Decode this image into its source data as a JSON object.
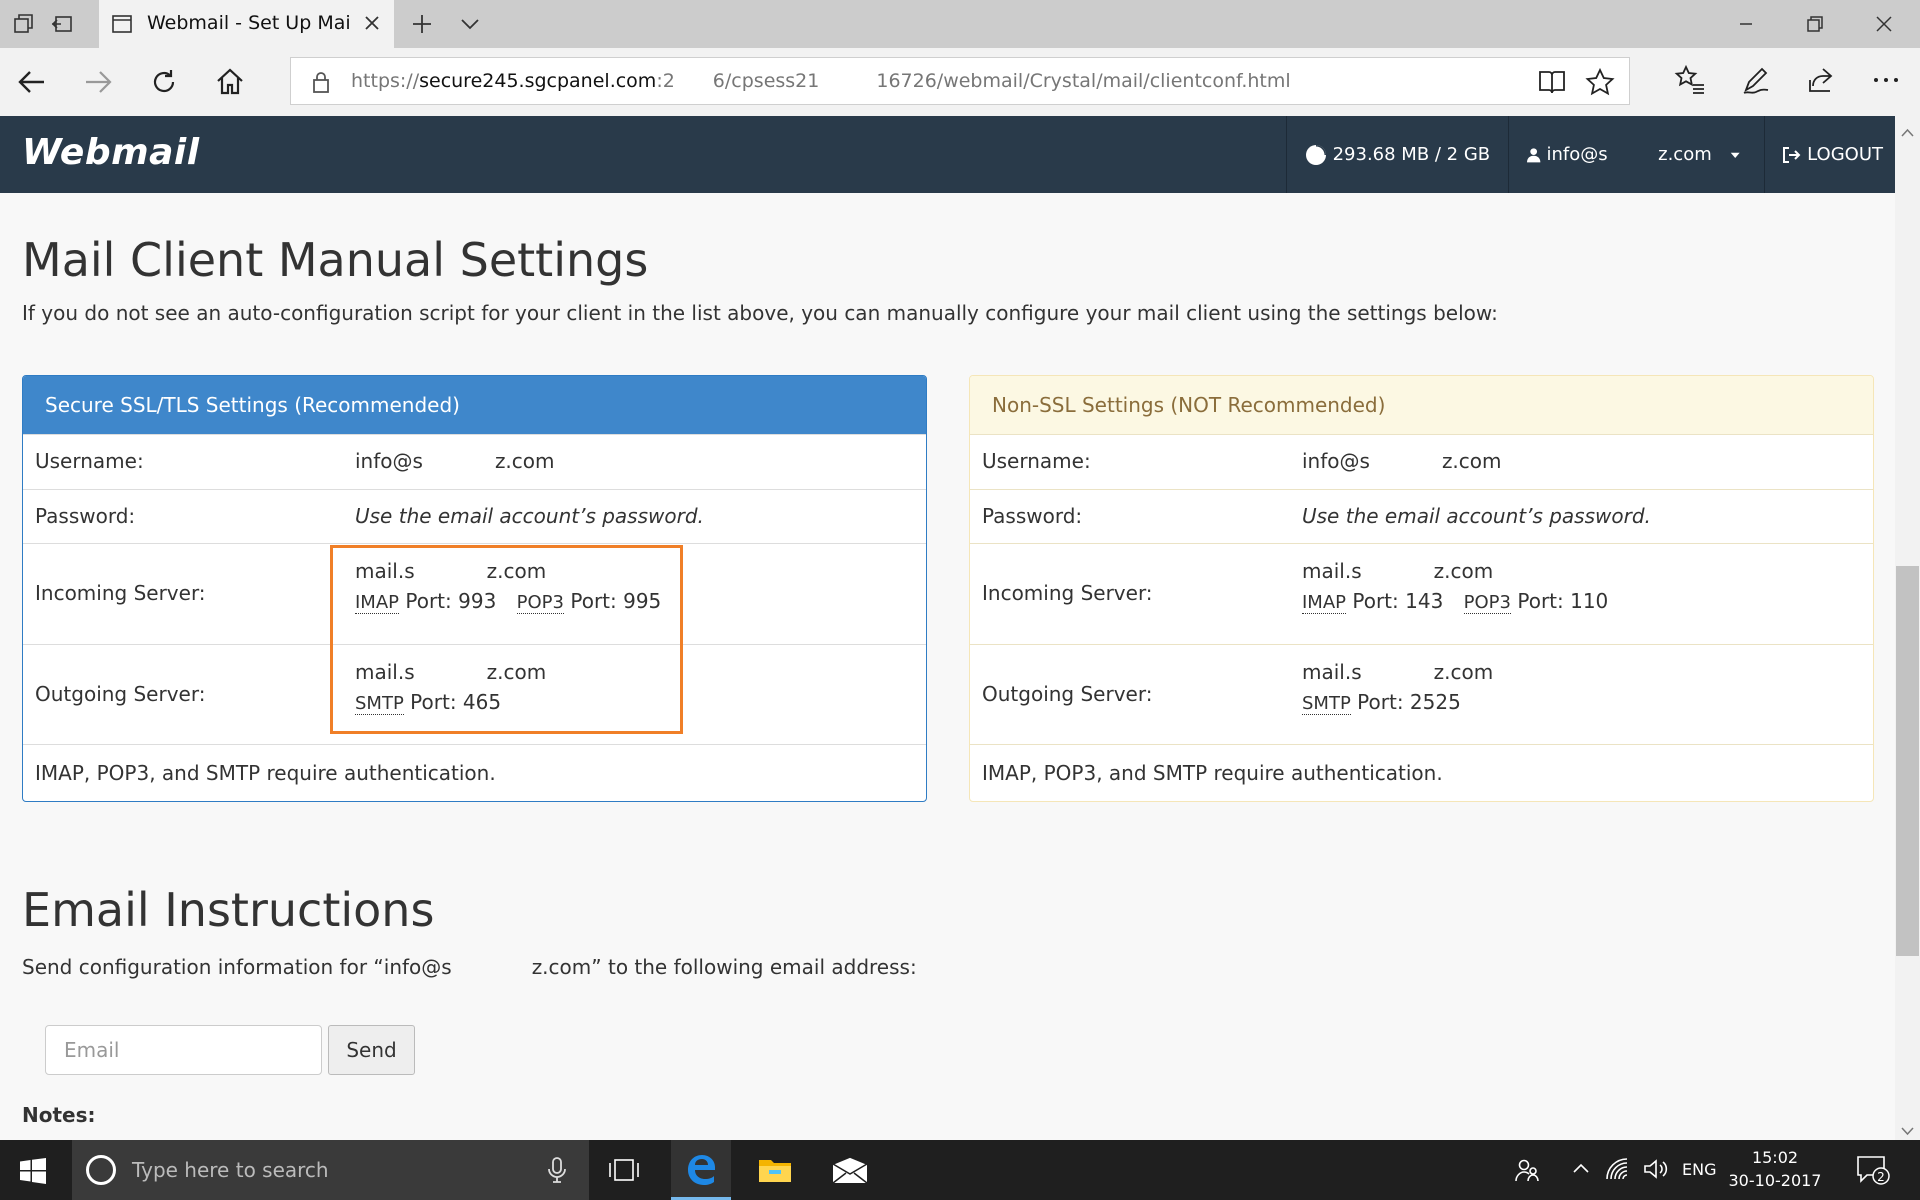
{
  "browser": {
    "tab_title": "Webmail - Set Up Mail Client",
    "url_scheme": "https://",
    "url_host": "secure245.sgcpanel.com",
    "url_rest": ":2  6/cpsess21   16726/webmail/Crystal/mail/clientconf.html"
  },
  "header": {
    "logo": "Webmail",
    "quota": "293.68 MB / 2 GB",
    "user": "info@s",
    "domain": "z.com",
    "logout": "LOGOUT"
  },
  "manual": {
    "title": "Mail Client Manual Settings",
    "description": "If you do not see an auto-configuration script for your client in the list above, you can manually configure your mail client using the settings below:"
  },
  "ssl": {
    "heading": "Secure SSL/TLS Settings (Recommended)",
    "username_label": "Username:",
    "username_prefix": "info@s",
    "username_suffix": "z.com",
    "password_label": "Password:",
    "password_value": "Use the email account’s password.",
    "incoming_label": "Incoming Server:",
    "incoming_host_prefix": "mail.s",
    "incoming_host_suffix": "z.com",
    "imap_abbr": "IMAP",
    "imap_port": "Port: 993",
    "pop3_abbr": "POP3",
    "pop3_port": "Port: 995",
    "outgoing_label": "Outgoing Server:",
    "outgoing_host_prefix": "mail.s",
    "outgoing_host_suffix": "z.com",
    "smtp_abbr": "SMTP",
    "smtp_port": "Port: 465",
    "auth_note": "IMAP, POP3, and SMTP require authentication."
  },
  "nonssl": {
    "heading": "Non-SSL Settings (NOT Recommended)",
    "username_label": "Username:",
    "username_prefix": "info@s",
    "username_suffix": "z.com",
    "password_label": "Password:",
    "password_value": "Use the email account’s password.",
    "incoming_label": "Incoming Server:",
    "incoming_host_prefix": "mail.s",
    "incoming_host_suffix": "z.com",
    "imap_abbr": "IMAP",
    "imap_port": "Port: 143",
    "pop3_abbr": "POP3",
    "pop3_port": "Port: 110",
    "outgoing_label": "Outgoing Server:",
    "outgoing_host_prefix": "mail.s",
    "outgoing_host_suffix": "z.com",
    "smtp_abbr": "SMTP",
    "smtp_port": "Port: 2525",
    "auth_note": "IMAP, POP3, and SMTP require authentication."
  },
  "instructions": {
    "title": "Email Instructions",
    "description": "Send configuration information for “info@s    z.com” to the following email address:",
    "email_placeholder": "Email",
    "send_label": "Send",
    "notes_label": "Notes:"
  },
  "taskbar": {
    "search_placeholder": "Type here to search",
    "language": "ENG",
    "time": "15:02",
    "date": "30-10-2017",
    "notification_count": "2"
  },
  "colors": {
    "header_bg": "#293a4a",
    "ssl_heading_bg": "#3f87cb",
    "nonssl_heading_bg": "#fcf8e3",
    "highlight_border": "#f07f27"
  }
}
